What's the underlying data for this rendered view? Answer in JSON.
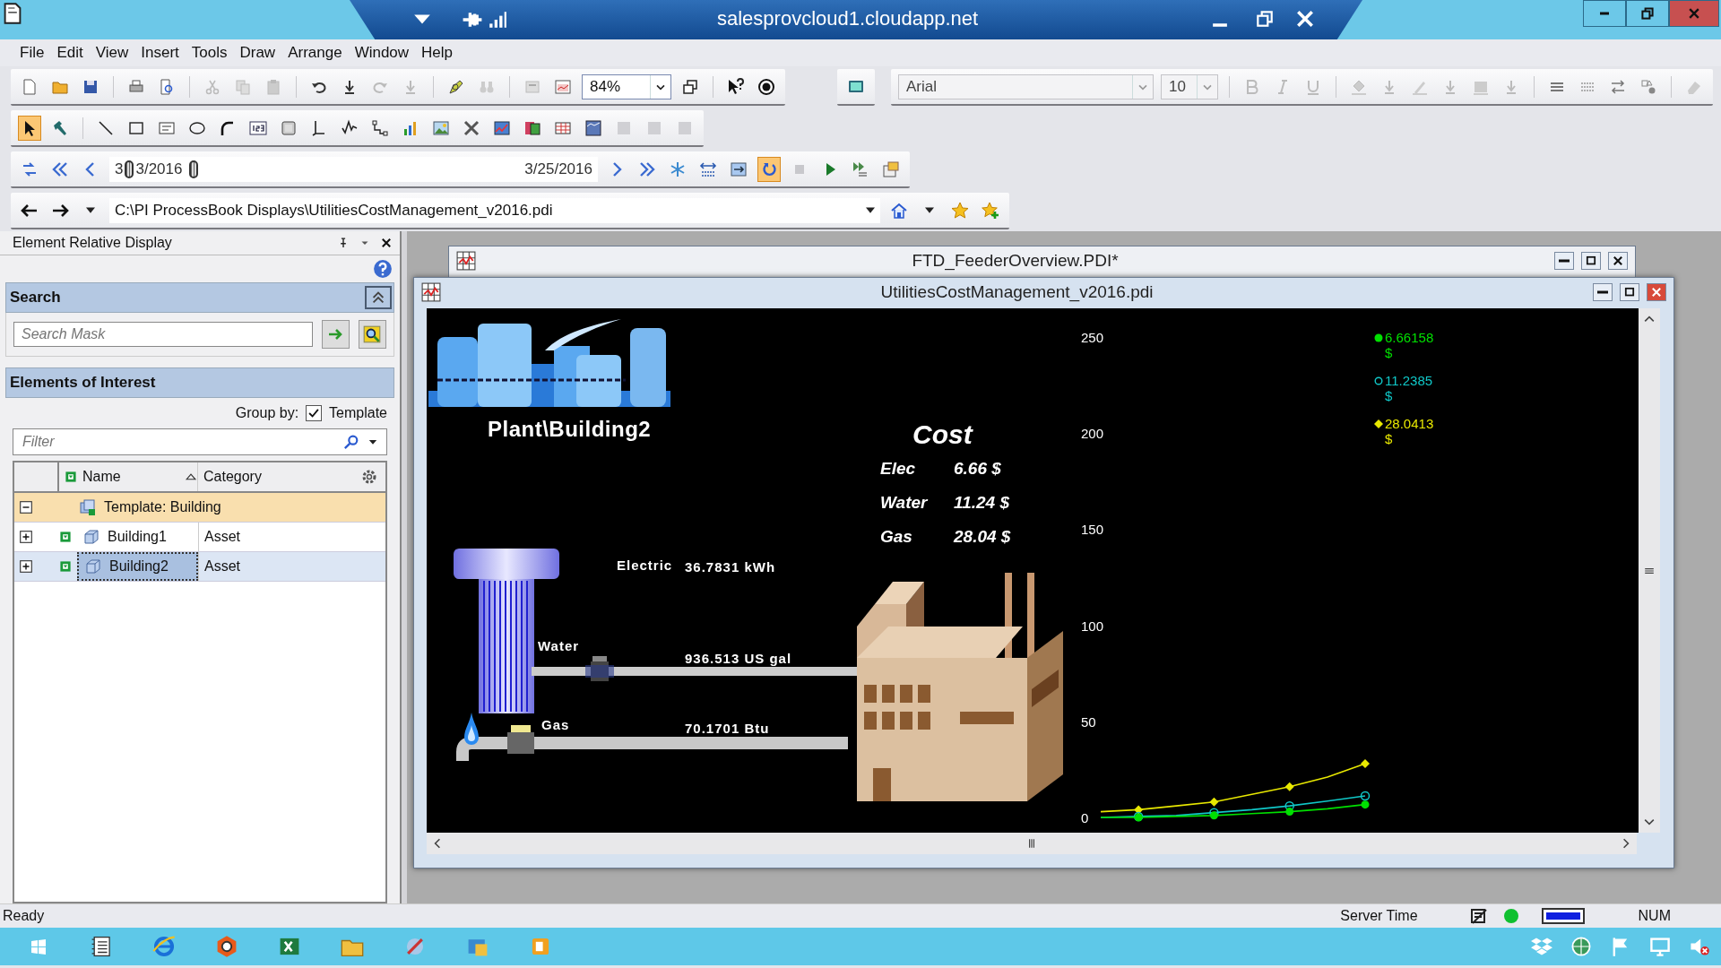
{
  "remote_bar": {
    "host": "salesprovcloud1.cloudapp.net"
  },
  "menu": [
    "File",
    "Edit",
    "View",
    "Insert",
    "Tools",
    "Draw",
    "Arrange",
    "Window",
    "Help"
  ],
  "zoom": {
    "value": "84%"
  },
  "font": {
    "name": "Arial",
    "size": "10"
  },
  "time_range": {
    "start_parts": [
      "3",
      "3/2016"
    ],
    "end": "3/25/2016"
  },
  "address": {
    "value": "C:\\PI ProcessBook Displays\\UtilitiesCostManagement_v2016.pdi"
  },
  "panel": {
    "title": "Element Relative Display",
    "search": {
      "title": "Search",
      "placeholder": "Search Mask"
    },
    "elements": {
      "title": "Elements of Interest",
      "group_by_label": "Group by:",
      "group_by": {
        "label": "Template",
        "checked": true
      },
      "filter_placeholder": "Filter",
      "columns": [
        "Name",
        "Category"
      ],
      "tree": [
        {
          "label": "Template: Building",
          "expanded": true,
          "children": [
            {
              "name": "Building1",
              "category": "Asset",
              "expanded": false,
              "selected": false
            },
            {
              "name": "Building2",
              "category": "Asset",
              "expanded": false,
              "selected": true
            }
          ]
        }
      ]
    }
  },
  "back_window": {
    "title": "FTD_FeederOverview.PDI*"
  },
  "display_window": {
    "title": "UtilitiesCostManagement_v2016.pdi",
    "building_label": "Plant\\Building2",
    "cost": {
      "title": "Cost",
      "rows": [
        {
          "label": "Elec",
          "value": "6.66 $"
        },
        {
          "label": "Water",
          "value": "11.24 $"
        },
        {
          "label": "Gas",
          "value": "28.04 $"
        }
      ]
    },
    "meters": [
      {
        "kind": "electric",
        "label": "Electric",
        "reading": "36.7831 kWh"
      },
      {
        "kind": "water",
        "label": "Water",
        "reading": "936.513 US gal"
      },
      {
        "kind": "gas",
        "label": "Gas",
        "reading": "70.1701 Btu"
      }
    ],
    "trend_legend": [
      {
        "kind": "dot",
        "value": "6.66158",
        "unit": "$",
        "color": "#00e000"
      },
      {
        "kind": "ring",
        "value": "11.2385",
        "unit": "$",
        "color": "#10c8c8"
      },
      {
        "kind": "diamond",
        "value": "28.0413",
        "unit": "$",
        "color": "#e8e800"
      }
    ],
    "chart_data": {
      "type": "line",
      "ylim": [
        0,
        250
      ],
      "yticks": [
        0,
        50,
        100,
        150,
        200,
        250
      ],
      "series": [
        {
          "color": "#00e000",
          "values": [
            0,
            0,
            0.5,
            1,
            2,
            3,
            4.5,
            6.7
          ]
        },
        {
          "color": "#10c8c8",
          "values": [
            0,
            0.5,
            1,
            2.5,
            4,
            6,
            8.5,
            11.2
          ]
        },
        {
          "color": "#e8e800",
          "values": [
            3,
            4,
            6,
            8,
            12,
            16,
            21,
            28
          ]
        }
      ]
    }
  },
  "status": {
    "text": "Ready",
    "server_time": "Server Time",
    "num": "NUM"
  }
}
